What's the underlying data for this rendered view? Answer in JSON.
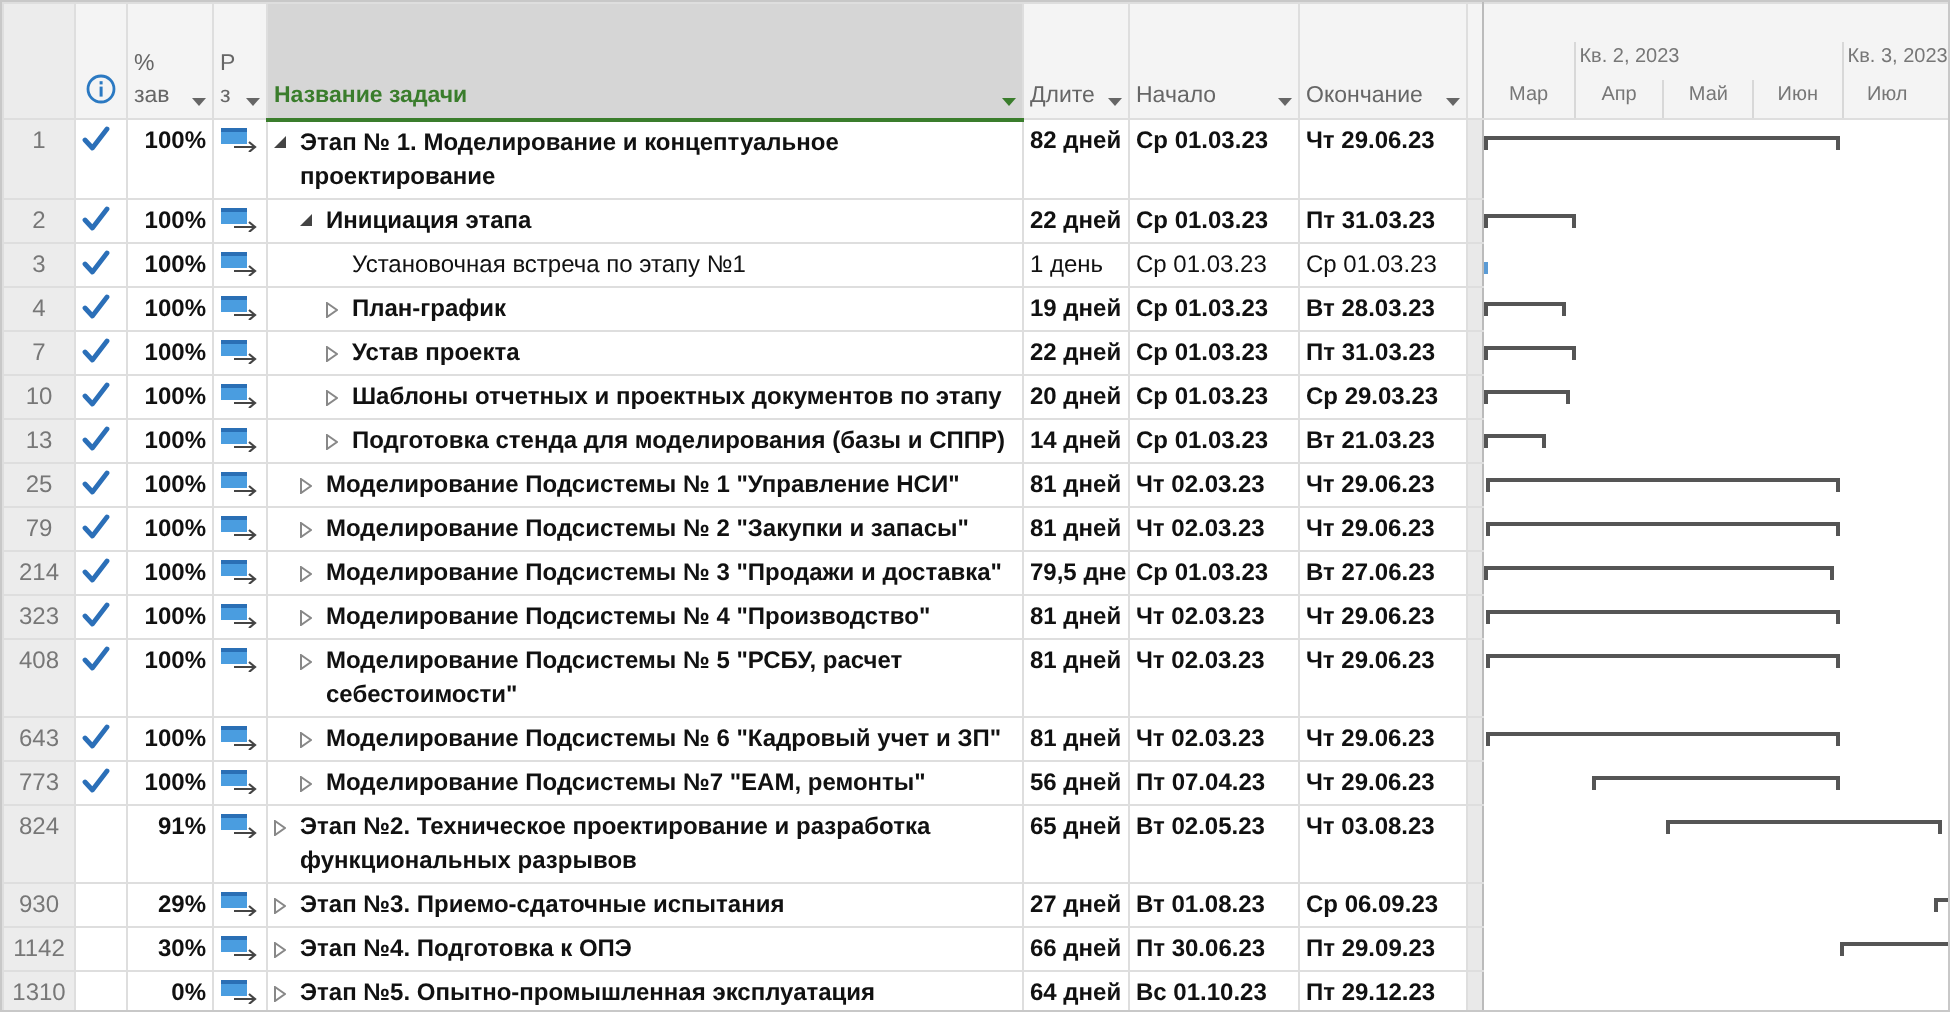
{
  "columns": [
    {
      "kind": "indicators",
      "selected": false
    },
    {
      "kind": "percent",
      "label": "% зав",
      "selected": false
    },
    {
      "kind": "mode",
      "label": "Р з",
      "selected": false
    },
    {
      "kind": "name",
      "label": "Название задачи",
      "selected": true
    },
    {
      "kind": "duration",
      "label": "Длите",
      "selected": false
    },
    {
      "kind": "start",
      "label": "Начало",
      "selected": false
    },
    {
      "kind": "finish",
      "label": "Окончание",
      "selected": false
    }
  ],
  "timescale": {
    "quarters": [
      "Кв. 2, 2023",
      "Кв. 3, 2023"
    ],
    "months": [
      "Мар",
      "Апр",
      "Май",
      "Июн",
      "Июл"
    ]
  },
  "rows": [
    {
      "id": "1",
      "kind": "summary",
      "expanded": true,
      "done": true,
      "percent": "100%",
      "name": "Этап № 1. Моделирование и концептуальное проектирование",
      "duration": "82 дней",
      "start": "Ср 01.03.23",
      "finish": "Чт 29.06.23",
      "children": [
        {
          "id": "2",
          "kind": "summary",
          "expanded": true,
          "done": true,
          "percent": "100%",
          "name": "Инициация этапа",
          "duration": "22 дней",
          "start": "Ср 01.03.23",
          "finish": "Пт 31.03.23",
          "children": [
            {
              "id": "3",
              "kind": "task",
              "done": true,
              "percent": "100%",
              "name": "Установочная встреча по этапу №1",
              "duration": "1 день",
              "start": "Ср 01.03.23",
              "finish": "Ср 01.03.23"
            },
            {
              "id": "4",
              "kind": "summary",
              "expanded": false,
              "done": true,
              "percent": "100%",
              "name": "План-график",
              "duration": "19 дней",
              "start": "Ср 01.03.23",
              "finish": "Вт 28.03.23"
            },
            {
              "id": "7",
              "kind": "summary",
              "expanded": false,
              "done": true,
              "percent": "100%",
              "name": "Устав проекта",
              "duration": "22 дней",
              "start": "Ср 01.03.23",
              "finish": "Пт 31.03.23"
            },
            {
              "id": "10",
              "kind": "summary",
              "expanded": false,
              "done": true,
              "percent": "100%",
              "name": "Шаблоны отчетных и проектных документов по этапу",
              "duration": "20 дней",
              "start": "Ср 01.03.23",
              "finish": "Ср 29.03.23"
            },
            {
              "id": "13",
              "kind": "summary",
              "expanded": false,
              "done": true,
              "percent": "100%",
              "name": "Подготовка стенда для моделирования (базы и СППР)",
              "duration": "14 дней",
              "start": "Ср 01.03.23",
              "finish": "Вт 21.03.23"
            }
          ]
        },
        {
          "id": "25",
          "kind": "summary",
          "expanded": false,
          "done": true,
          "percent": "100%",
          "name": "Моделирование Подсистемы № 1 \"Управление НСИ\"",
          "duration": "81 дней",
          "start": "Чт 02.03.23",
          "finish": "Чт 29.06.23"
        },
        {
          "id": "79",
          "kind": "summary",
          "expanded": false,
          "done": true,
          "percent": "100%",
          "name": "Моделирование Подсистемы № 2 \"Закупки и запасы\"",
          "duration": "81 дней",
          "start": "Чт 02.03.23",
          "finish": "Чт 29.06.23"
        },
        {
          "id": "214",
          "kind": "summary",
          "expanded": false,
          "done": true,
          "percent": "100%",
          "name": "Моделирование Подсистемы № 3 \"Продажи и доставка\"",
          "duration": "79,5 дне",
          "start": "Ср 01.03.23",
          "finish": "Вт 27.06.23"
        },
        {
          "id": "323",
          "kind": "summary",
          "expanded": false,
          "done": true,
          "percent": "100%",
          "name": "Моделирование Подсистемы № 4 \"Производство\"",
          "duration": "81 дней",
          "start": "Чт 02.03.23",
          "finish": "Чт 29.06.23"
        },
        {
          "id": "408",
          "kind": "summary",
          "expanded": false,
          "done": true,
          "percent": "100%",
          "name": "Моделирование Подсистемы № 5 \"РСБУ, расчет себестоимости\"",
          "duration": "81 дней",
          "start": "Чт 02.03.23",
          "finish": "Чт 29.06.23"
        },
        {
          "id": "643",
          "kind": "summary",
          "expanded": false,
          "done": true,
          "percent": "100%",
          "name": "Моделирование Подсистемы № 6 \"Кадровый учет и ЗП\"",
          "duration": "81 дней",
          "start": "Чт 02.03.23",
          "finish": "Чт 29.06.23"
        },
        {
          "id": "773",
          "kind": "summary",
          "expanded": false,
          "done": true,
          "percent": "100%",
          "name": "Моделирование Подсистемы №7 \"ЕАМ, ремонты\"",
          "duration": "56 дней",
          "start": "Пт 07.04.23",
          "finish": "Чт 29.06.23"
        }
      ]
    },
    {
      "id": "824",
      "kind": "summary",
      "expanded": false,
      "done": false,
      "percent": "91%",
      "name": "Этап №2. Техническое проектирование и разработка функциональных разрывов",
      "duration": "65 дней",
      "start": "Вт 02.05.23",
      "finish": "Чт 03.08.23"
    },
    {
      "id": "930",
      "kind": "summary",
      "expanded": false,
      "done": false,
      "percent": "29%",
      "name": "Этап №3. Приемо-сдаточные испытания",
      "duration": "27 дней",
      "start": "Вт 01.08.23",
      "finish": "Ср 06.09.23"
    },
    {
      "id": "1142",
      "kind": "summary",
      "expanded": false,
      "done": false,
      "percent": "30%",
      "name": "Этап №4. Подготовка к ОПЭ",
      "duration": "66 дней",
      "start": "Пт 30.06.23",
      "finish": "Пт 29.09.23"
    },
    {
      "id": "1310",
      "kind": "summary",
      "expanded": false,
      "done": false,
      "percent": "0%",
      "name": "Этап №5. Опытно-промышленная эксплуатация",
      "duration": "64 дней",
      "start": "Вс 01.10.23",
      "finish": "Пт 29.12.23"
    }
  ]
}
